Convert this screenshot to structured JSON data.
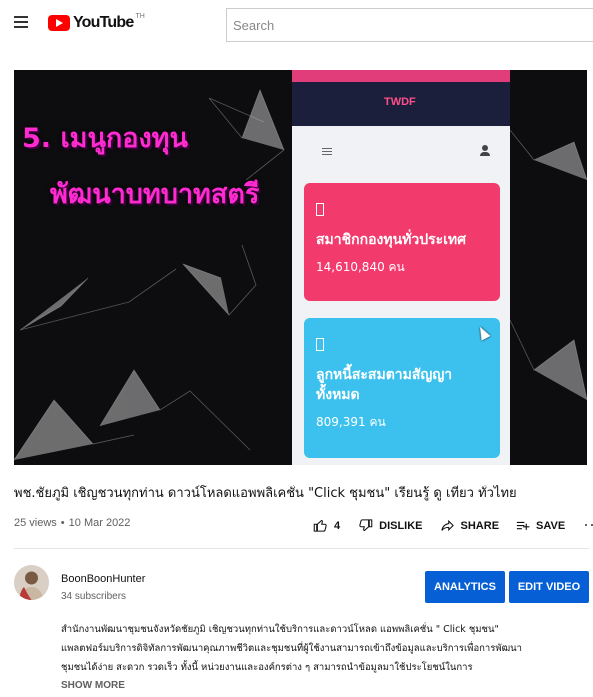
{
  "header": {
    "logo_text": "YouTube",
    "region": "TH",
    "search_placeholder": "Search"
  },
  "player": {
    "overlay_line1": "5. เมนูกองทุน",
    "overlay_line2": "พัฒนาบทบาทสตรี",
    "app_logo": "TWDF",
    "cards": [
      {
        "title": "สมาชิกกองทุนทั่วประเทศ",
        "value": "14,610,840 คน",
        "color": "#f23a6c"
      },
      {
        "title": "ลูกหนี้สะสมตามสัญญาทั้งหมด",
        "value": "809,391 คน",
        "color": "#3cc1ee"
      }
    ]
  },
  "video": {
    "title": "พช.ชัยภูมิ เชิญชวนทุกท่าน ดาวน์โหลดแอพพลิเคชั่น \"Click ชุมชน\" เรียนรู้ ดู เที่ยว ทั่วไทย",
    "views": "25 views",
    "date": "10 Mar 2022",
    "like_count": "4",
    "dislike_label": "DISLIKE",
    "share_label": "SHARE",
    "save_label": "SAVE"
  },
  "channel": {
    "name": "BoonBoonHunter",
    "subscribers": "34 subscribers",
    "analytics_label": "ANALYTICS",
    "edit_label": "EDIT VIDEO"
  },
  "description": {
    "text": "สำนักงานพัฒนาชุมชนจังหวัดชัยภูมิ เชิญชวนทุกท่านใช้บริการและดาวน์โหลด แอพพลิเคชั่น \" Click ชุมชน\" แพลตฟอร์มบริการดิจิทัลการพัฒนาคุณภาพชีวิตและชุมชนที่ผู้ใช้งานสามารถเข้าถึงข้อมูลและบริการเพื่อการพัฒนาชุมชนได้ง่าย สะดวก รวดเร็ว ทั้งนี้ หน่วยงานและองค์กรต่าง ๆ สามารถนำข้อมูลมาใช้ประโยชน์ในการ",
    "show_more": "SHOW MORE"
  }
}
